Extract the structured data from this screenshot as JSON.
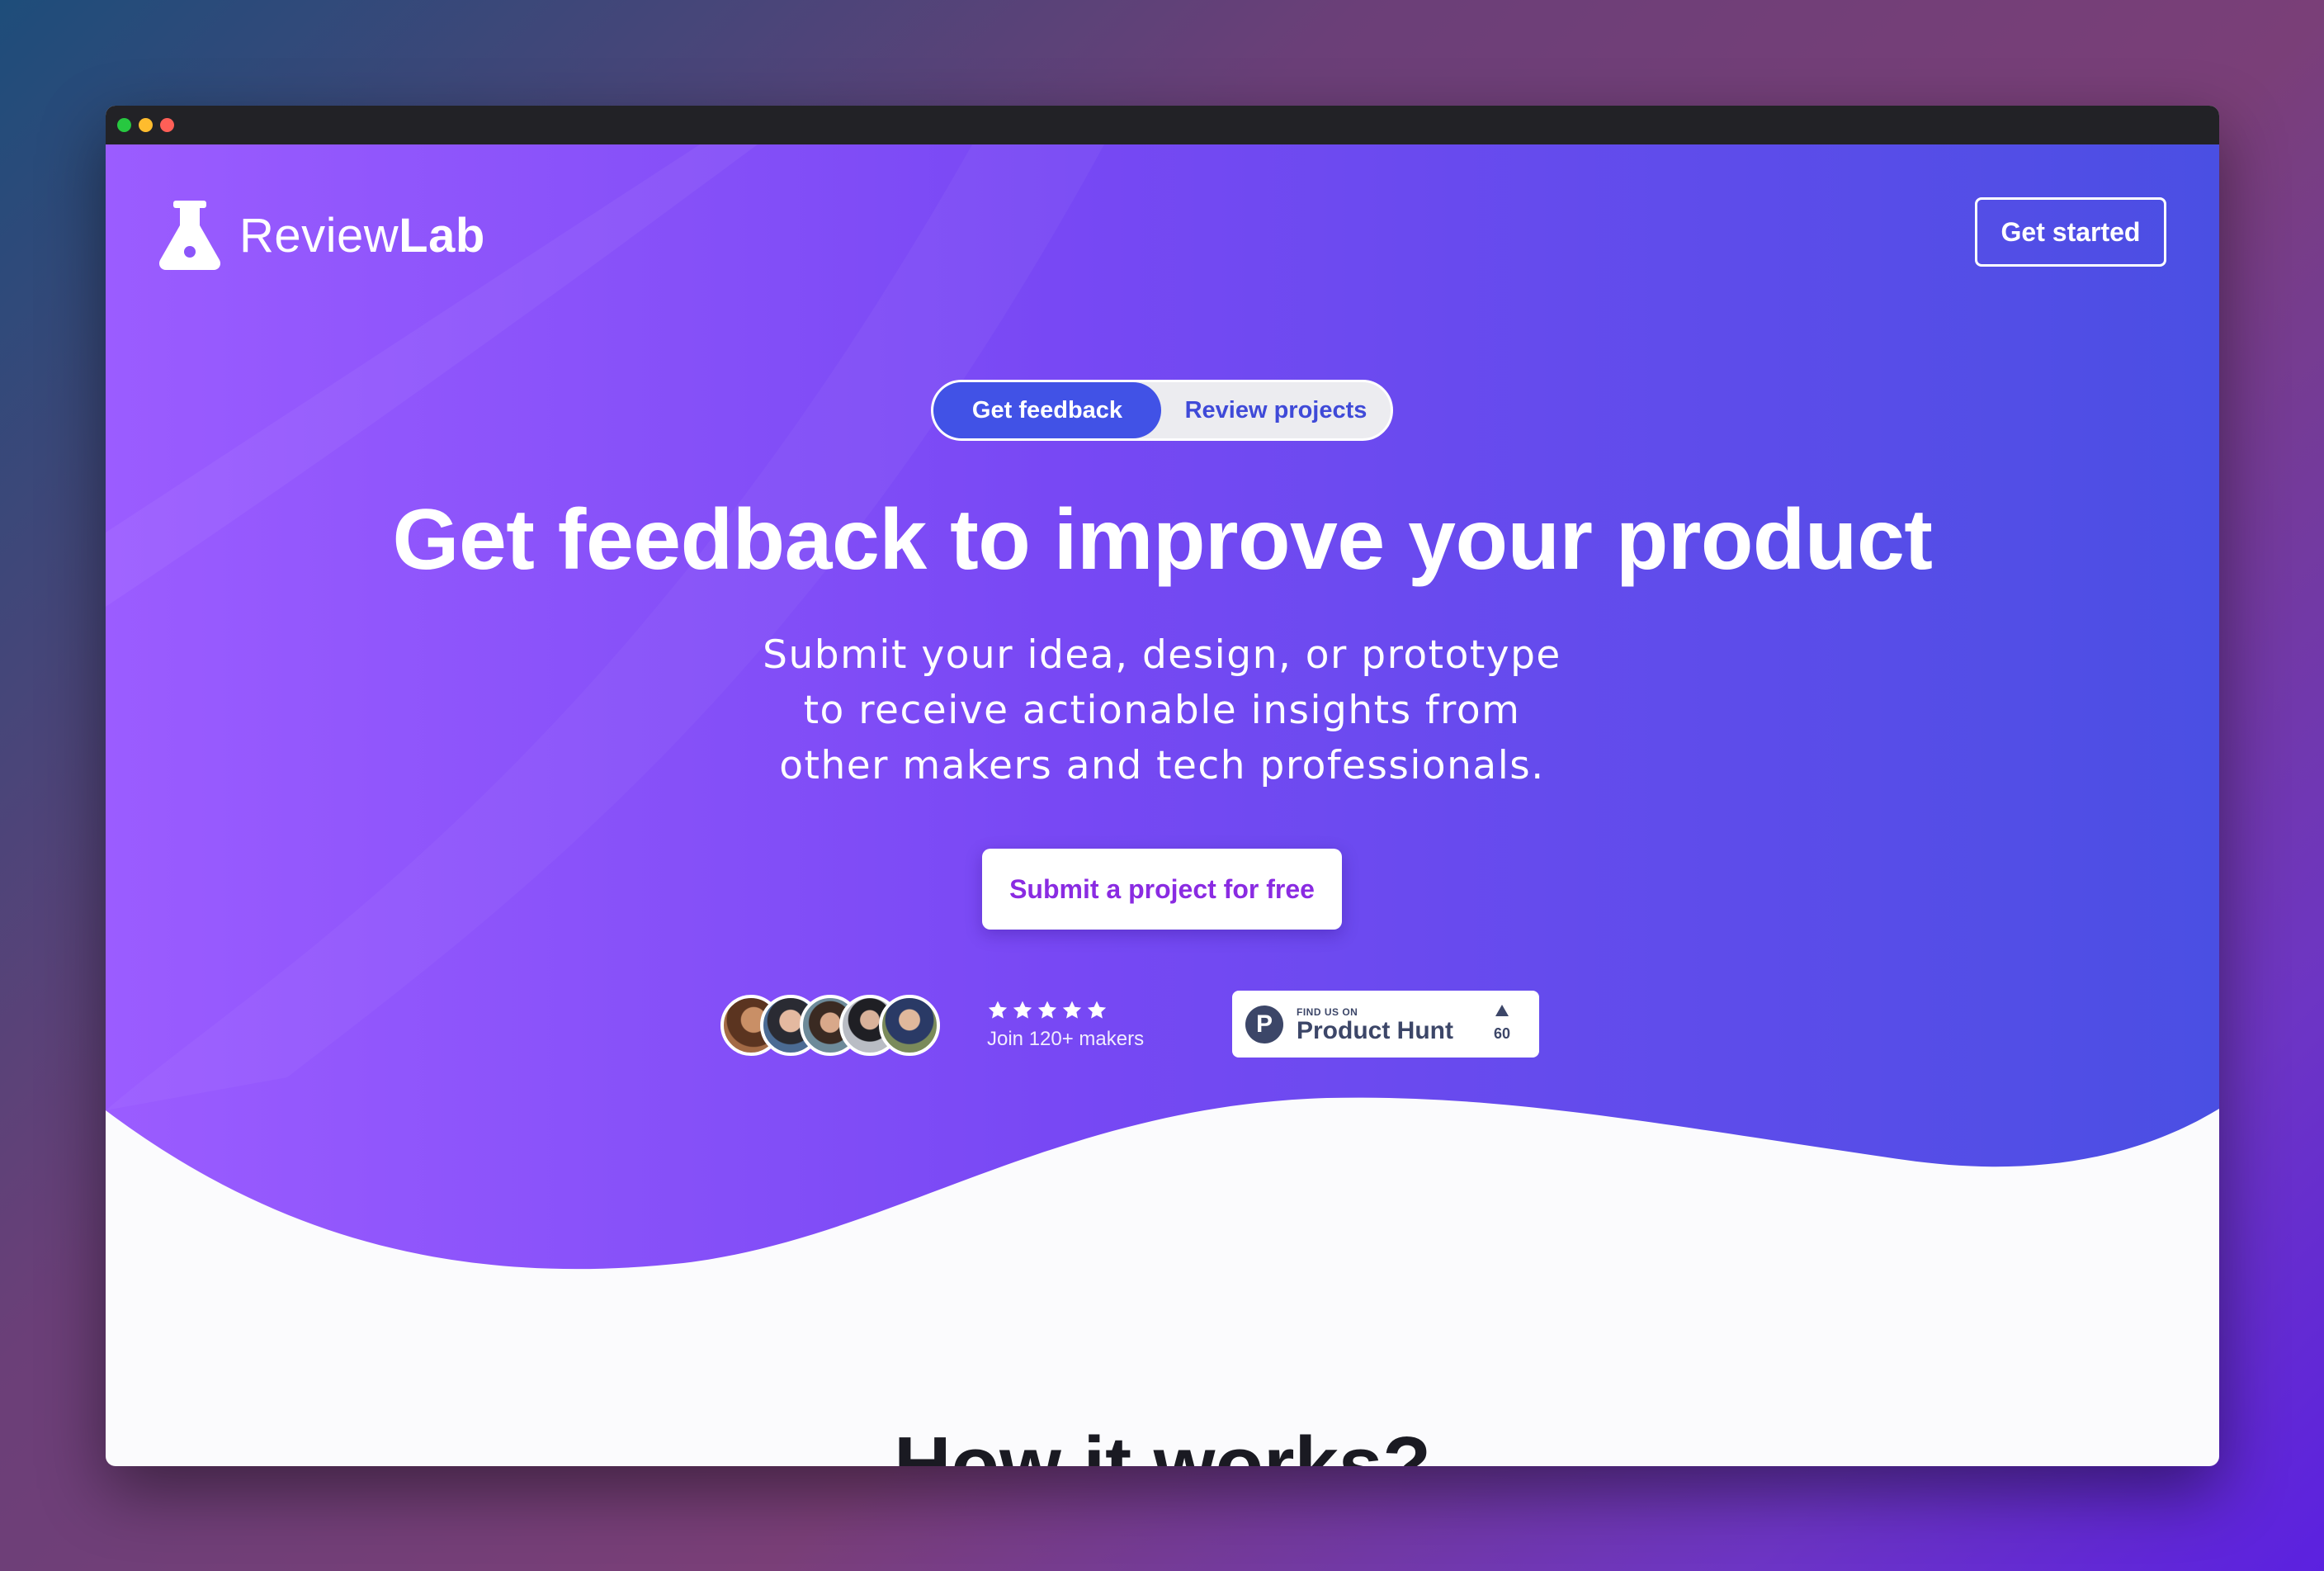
{
  "brand": {
    "name_light": "Review",
    "name_bold": "Lab"
  },
  "nav": {
    "cta_label": "Get started"
  },
  "toggle": {
    "active_label": "Get feedback",
    "inactive_label": "Review projects"
  },
  "hero": {
    "headline": "Get feedback to improve your product",
    "sub_lines": [
      "Submit your idea, design, or prototype",
      "to receive actionable insights from",
      "other makers and tech professionals."
    ],
    "submit_label": "Submit a project for free"
  },
  "social_proof": {
    "avatars": [
      "avatar-1",
      "avatar-2",
      "avatar-3",
      "avatar-4",
      "avatar-5"
    ],
    "stars": 5,
    "join_text": "Join 120+ makers"
  },
  "product_hunt": {
    "small_label": "FIND US ON",
    "name": "Product Hunt",
    "letter": "P",
    "count": "60"
  },
  "section": {
    "how_title": "How it works?"
  },
  "colors": {
    "accent": "#4152e6",
    "submit_text": "#8a2be2",
    "gradient_start": "#9b5cff",
    "gradient_end": "#4a4fe3"
  }
}
